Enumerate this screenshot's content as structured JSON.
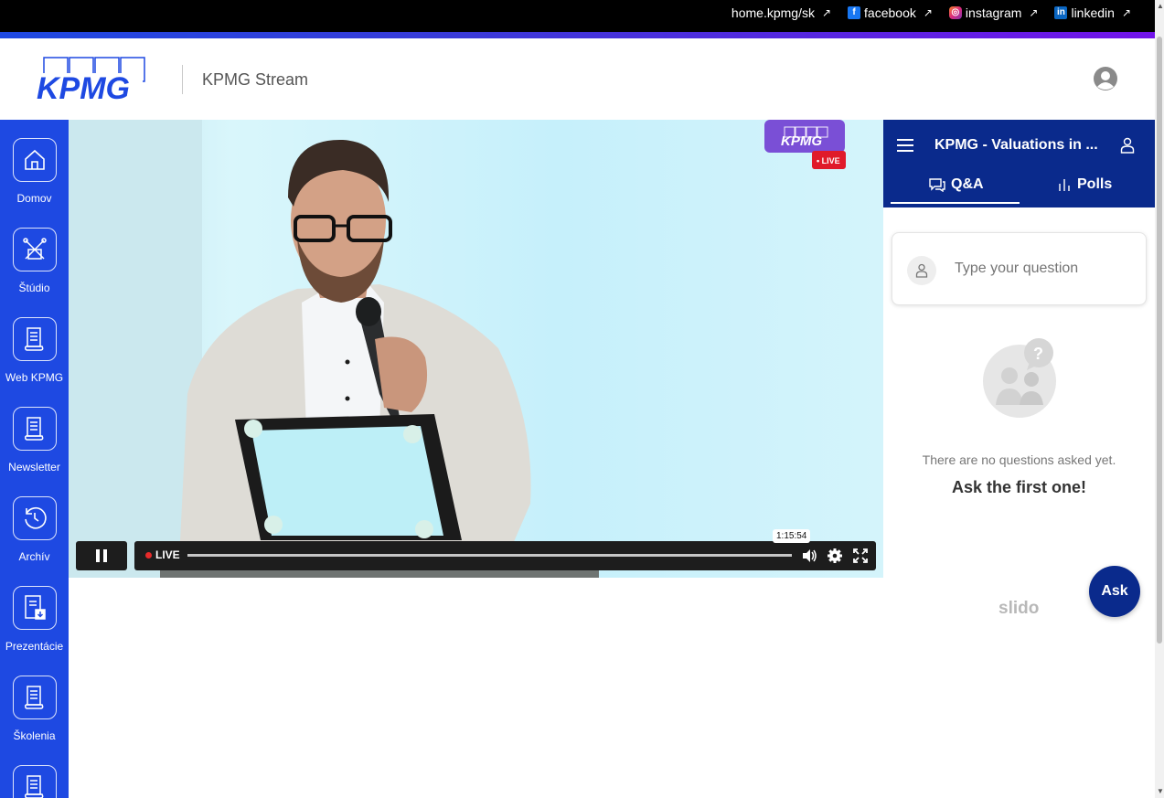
{
  "topbar": {
    "links": [
      {
        "label": "home.kpmg/sk",
        "icon": "external-link-icon"
      },
      {
        "label": "facebook",
        "icon": "facebook-icon"
      },
      {
        "label": "instagram",
        "icon": "instagram-icon"
      },
      {
        "label": "linkedin",
        "icon": "linkedin-icon"
      }
    ]
  },
  "header": {
    "logo_text": "KPMG",
    "title": "KPMG Stream"
  },
  "sidebar": {
    "items": [
      {
        "label": "Domov",
        "icon": "home-icon"
      },
      {
        "label": "Štúdio",
        "icon": "studio-icon"
      },
      {
        "label": "Web KPMG",
        "icon": "document-icon"
      },
      {
        "label": "Newsletter",
        "icon": "document-icon"
      },
      {
        "label": "Archív",
        "icon": "history-icon"
      },
      {
        "label": "Prezentácie",
        "icon": "presentation-download-icon"
      },
      {
        "label": "Školenia",
        "icon": "document-icon"
      },
      {
        "label": "",
        "icon": "document-icon"
      }
    ]
  },
  "video": {
    "badge_logo": "KPMG",
    "badge_live": "• LIVE",
    "live_label": "LIVE",
    "time_tooltip": "1:15:54",
    "progress_fraction": 1.0
  },
  "slido": {
    "event_title": "KPMG - Valuations in ...",
    "tabs": [
      {
        "label": "Q&A",
        "active": true
      },
      {
        "label": "Polls",
        "active": false
      }
    ],
    "question_placeholder": "Type your question",
    "empty_line1": "There are no questions asked yet.",
    "empty_line2": "Ask the first one!",
    "ask_button": "Ask",
    "brand": "slido"
  },
  "colors": {
    "sidebar": "#1e49e2",
    "slido_header": "#0a2a8c",
    "gradient_start": "#1e49e2",
    "gradient_end": "#7213ea",
    "live_red": "#e62a2a"
  }
}
